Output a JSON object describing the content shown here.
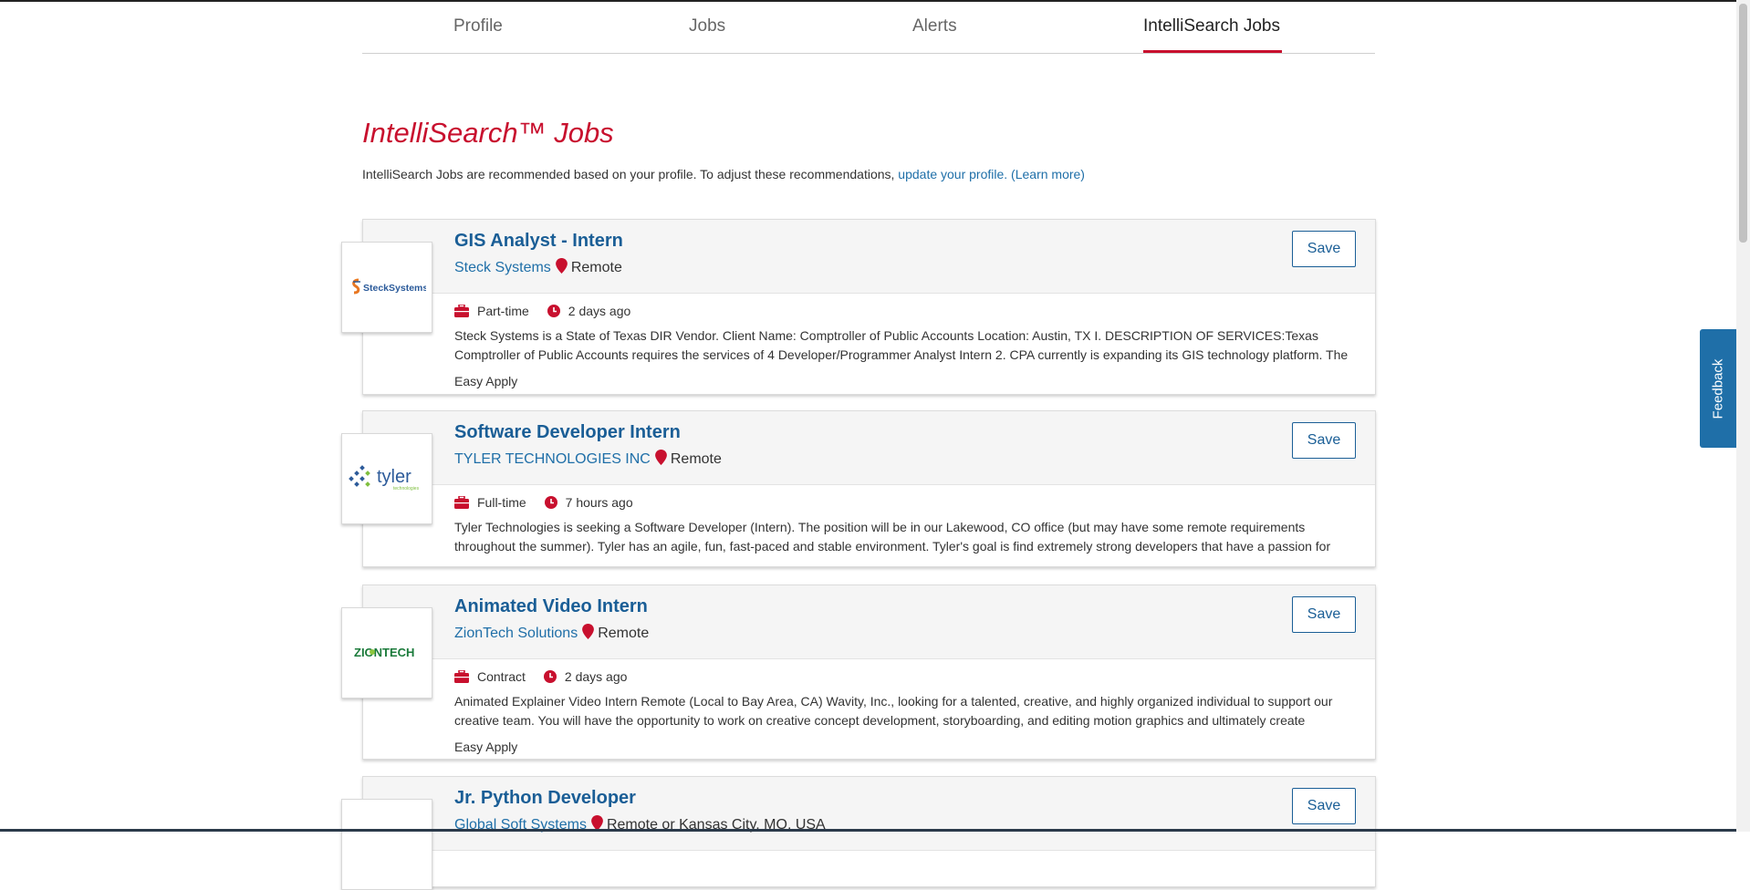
{
  "tabs": [
    {
      "label": "Profile"
    },
    {
      "label": "Jobs"
    },
    {
      "label": "Alerts"
    },
    {
      "label": "IntelliSearch Jobs",
      "active": true
    }
  ],
  "heading": "IntelliSearch™ Jobs",
  "intro": {
    "text": "IntelliSearch Jobs are recommended based on your profile. To adjust these recommendations, ",
    "link": "update your profile.",
    "learn_more": "(Learn more)"
  },
  "jobs": [
    {
      "title": "GIS Analyst - Intern",
      "company": "Steck Systems",
      "location": "Remote",
      "save": "Save",
      "type": "Part-time",
      "posted": "2 days ago",
      "description": "Steck Systems is a State of Texas DIR Vendor. Client Name: Comptroller of Public Accounts Location: Austin, TX I. DESCRIPTION OF SERVICES:Texas Comptroller of Public Accounts requires the services of 4 Developer/Programmer Analyst Intern 2. CPA currently is expanding its GIS technology platform. The",
      "easy_apply": "Easy Apply",
      "logo_text": "SteckSystems",
      "logo_icon": "steck-systems-logo"
    },
    {
      "title": "Software Developer Intern",
      "company": "TYLER TECHNOLOGIES INC",
      "location": "Remote",
      "save": "Save",
      "type": "Full-time",
      "posted": "7 hours ago",
      "description": "Tyler Technologies is seeking a Software Developer (Intern). The position will be in our Lakewood, CO office (but may have some remote requirements throughout the summer). Tyler has an agile, fun, fast-paced and stable environment. Tyler's goal is find extremely strong developers that have a passion for",
      "logo_text": "tyler",
      "logo_subtext": "technologies",
      "logo_icon": "tyler-technologies-logo"
    },
    {
      "title": "Animated Video Intern",
      "company": "ZionTech Solutions",
      "location": "Remote",
      "save": "Save",
      "type": "Contract",
      "posted": "2 days ago",
      "description": "Animated Explainer Video Intern Remote (Local to Bay Area, CA) Wavity, Inc., looking for a talented, creative, and highly organized individual to support our creative team. You will have the opportunity to work on creative concept development, storyboarding, and editing motion graphics and ultimately create",
      "easy_apply": "Easy Apply",
      "logo_text": "ZIONTECH",
      "logo_icon": "ziontech-logo"
    },
    {
      "title": "Jr. Python Developer",
      "company": "Global Soft Systems",
      "location": "Remote or Kansas City, MO, USA",
      "save": "Save"
    }
  ],
  "feedback": "Feedback",
  "colors": {
    "accent_red": "#c8102e",
    "link_blue": "#1f6fa8",
    "title_blue": "#1a5e96"
  },
  "icons": {
    "briefcase": "briefcase-icon",
    "clock": "clock-icon",
    "pin": "map-pin-icon"
  }
}
